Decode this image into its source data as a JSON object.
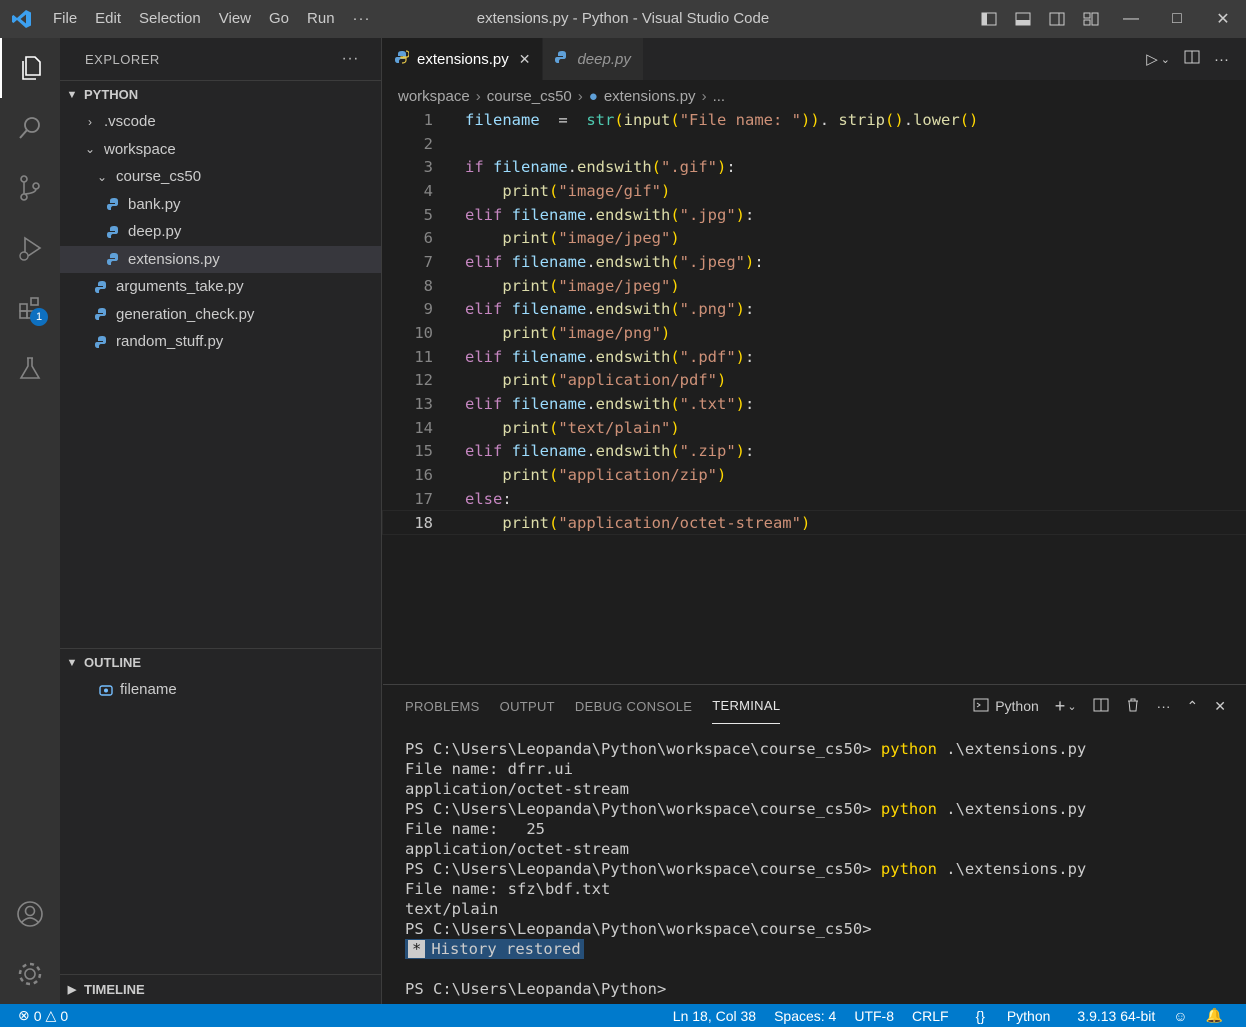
{
  "titlebar": {
    "menu": [
      "File",
      "Edit",
      "Selection",
      "View",
      "Go",
      "Run"
    ],
    "more": "···",
    "title": "extensions.py - Python - Visual Studio Code"
  },
  "activity": {
    "extensions_badge": "1"
  },
  "explorer": {
    "header": "EXPLORER",
    "section": "PYTHON",
    "tree": [
      {
        "label": ".vscode",
        "type": "folder",
        "expanded": false,
        "depth": 1
      },
      {
        "label": "workspace",
        "type": "folder",
        "expanded": true,
        "depth": 1
      },
      {
        "label": "course_cs50",
        "type": "folder",
        "expanded": true,
        "depth": 2
      },
      {
        "label": "bank.py",
        "type": "file",
        "depth": 3
      },
      {
        "label": "deep.py",
        "type": "file",
        "depth": 3
      },
      {
        "label": "extensions.py",
        "type": "file",
        "depth": 3,
        "selected": true
      },
      {
        "label": "arguments_take.py",
        "type": "file",
        "depth": 2
      },
      {
        "label": "generation_check.py",
        "type": "file",
        "depth": 2
      },
      {
        "label": "random_stuff.py",
        "type": "file",
        "depth": 2
      }
    ],
    "outline_title": "OUTLINE",
    "outline_item": "filename",
    "timeline_title": "TIMELINE"
  },
  "tabs": [
    {
      "label": "extensions.py",
      "active": true
    },
    {
      "label": "deep.py",
      "active": false
    }
  ],
  "breadcrumb": [
    "workspace",
    "course_cs50",
    "extensions.py",
    "..."
  ],
  "code_lines": [
    [
      [
        "var",
        "filename"
      ],
      [
        "",
        "  =  "
      ],
      [
        "bi",
        "str"
      ],
      [
        "pn",
        "("
      ],
      [
        "fn",
        "input"
      ],
      [
        "pn",
        "("
      ],
      [
        "str",
        "\"File name: \""
      ],
      [
        "pn",
        "))"
      ],
      [
        "",
        ". "
      ],
      [
        "fn",
        "strip"
      ],
      [
        "pn",
        "()"
      ],
      [
        "",
        "."
      ],
      [
        "fn",
        "lower"
      ],
      [
        "pn",
        "()"
      ]
    ],
    [],
    [
      [
        "kw",
        "if"
      ],
      [
        "",
        " "
      ],
      [
        "var",
        "filename"
      ],
      [
        "",
        "."
      ],
      [
        "fn",
        "endswith"
      ],
      [
        "pn",
        "("
      ],
      [
        "str",
        "\".gif\""
      ],
      [
        "pn",
        ")"
      ],
      [
        "",
        ":"
      ]
    ],
    [
      [
        "",
        "    "
      ],
      [
        "fn",
        "print"
      ],
      [
        "pn",
        "("
      ],
      [
        "str",
        "\"image/gif\""
      ],
      [
        "pn",
        ")"
      ]
    ],
    [
      [
        "kw",
        "elif"
      ],
      [
        "",
        " "
      ],
      [
        "var",
        "filename"
      ],
      [
        "",
        "."
      ],
      [
        "fn",
        "endswith"
      ],
      [
        "pn",
        "("
      ],
      [
        "str",
        "\".jpg\""
      ],
      [
        "pn",
        ")"
      ],
      [
        "",
        ":"
      ]
    ],
    [
      [
        "",
        "    "
      ],
      [
        "fn",
        "print"
      ],
      [
        "pn",
        "("
      ],
      [
        "str",
        "\"image/jpeg\""
      ],
      [
        "pn",
        ")"
      ]
    ],
    [
      [
        "kw",
        "elif"
      ],
      [
        "",
        " "
      ],
      [
        "var",
        "filename"
      ],
      [
        "",
        "."
      ],
      [
        "fn",
        "endswith"
      ],
      [
        "pn",
        "("
      ],
      [
        "str",
        "\".jpeg\""
      ],
      [
        "pn",
        ")"
      ],
      [
        "",
        ":"
      ]
    ],
    [
      [
        "",
        "    "
      ],
      [
        "fn",
        "print"
      ],
      [
        "pn",
        "("
      ],
      [
        "str",
        "\"image/jpeg\""
      ],
      [
        "pn",
        ")"
      ]
    ],
    [
      [
        "kw",
        "elif"
      ],
      [
        "",
        " "
      ],
      [
        "var",
        "filename"
      ],
      [
        "",
        "."
      ],
      [
        "fn",
        "endswith"
      ],
      [
        "pn",
        "("
      ],
      [
        "str",
        "\".png\""
      ],
      [
        "pn",
        ")"
      ],
      [
        "",
        ":"
      ]
    ],
    [
      [
        "",
        "    "
      ],
      [
        "fn",
        "print"
      ],
      [
        "pn",
        "("
      ],
      [
        "str",
        "\"image/png\""
      ],
      [
        "pn",
        ")"
      ]
    ],
    [
      [
        "kw",
        "elif"
      ],
      [
        "",
        " "
      ],
      [
        "var",
        "filename"
      ],
      [
        "",
        "."
      ],
      [
        "fn",
        "endswith"
      ],
      [
        "pn",
        "("
      ],
      [
        "str",
        "\".pdf\""
      ],
      [
        "pn",
        ")"
      ],
      [
        "",
        ":"
      ]
    ],
    [
      [
        "",
        "    "
      ],
      [
        "fn",
        "print"
      ],
      [
        "pn",
        "("
      ],
      [
        "str",
        "\"application/pdf\""
      ],
      [
        "pn",
        ")"
      ]
    ],
    [
      [
        "kw",
        "elif"
      ],
      [
        "",
        " "
      ],
      [
        "var",
        "filename"
      ],
      [
        "",
        "."
      ],
      [
        "fn",
        "endswith"
      ],
      [
        "pn",
        "("
      ],
      [
        "str",
        "\".txt\""
      ],
      [
        "pn",
        ")"
      ],
      [
        "",
        ":"
      ]
    ],
    [
      [
        "",
        "    "
      ],
      [
        "fn",
        "print"
      ],
      [
        "pn",
        "("
      ],
      [
        "str",
        "\"text/plain\""
      ],
      [
        "pn",
        ")"
      ]
    ],
    [
      [
        "kw",
        "elif"
      ],
      [
        "",
        " "
      ],
      [
        "var",
        "filename"
      ],
      [
        "",
        "."
      ],
      [
        "fn",
        "endswith"
      ],
      [
        "pn",
        "("
      ],
      [
        "str",
        "\".zip\""
      ],
      [
        "pn",
        ")"
      ],
      [
        "",
        ":"
      ]
    ],
    [
      [
        "",
        "    "
      ],
      [
        "fn",
        "print"
      ],
      [
        "pn",
        "("
      ],
      [
        "str",
        "\"application/zip\""
      ],
      [
        "pn",
        ")"
      ]
    ],
    [
      [
        "kw",
        "else"
      ],
      [
        "",
        ":"
      ]
    ],
    [
      [
        "",
        "    "
      ],
      [
        "fn",
        "print"
      ],
      [
        "pn",
        "("
      ],
      [
        "str",
        "\"application/octet-stream\""
      ],
      [
        "pn",
        ")"
      ]
    ]
  ],
  "current_line": 18,
  "panel": {
    "tabs": [
      "PROBLEMS",
      "OUTPUT",
      "DEBUG CONSOLE",
      "TERMINAL"
    ],
    "active_tab": "TERMINAL",
    "shell_label": "Python"
  },
  "terminal_lines": [
    [
      [
        "",
        "PS C:\\Users\\Leopanda\\Python\\workspace\\course_cs50> "
      ],
      [
        "cmd",
        "python"
      ],
      [
        "",
        " .\\extensions.py"
      ]
    ],
    [
      [
        "",
        "File name: dfrr.ui"
      ]
    ],
    [
      [
        "",
        "application/octet-stream"
      ]
    ],
    [
      [
        "",
        "PS C:\\Users\\Leopanda\\Python\\workspace\\course_cs50> "
      ],
      [
        "cmd",
        "python"
      ],
      [
        "",
        " .\\extensions.py"
      ]
    ],
    [
      [
        "",
        "File name:   25"
      ]
    ],
    [
      [
        "",
        "application/octet-stream"
      ]
    ],
    [
      [
        "",
        "PS C:\\Users\\Leopanda\\Python\\workspace\\course_cs50> "
      ],
      [
        "cmd",
        "python"
      ],
      [
        "",
        " .\\extensions.py"
      ]
    ],
    [
      [
        "",
        "File name: sfz\\bdf.txt"
      ]
    ],
    [
      [
        "",
        "text/plain"
      ]
    ],
    [
      [
        "",
        "PS C:\\Users\\Leopanda\\Python\\workspace\\course_cs50>"
      ]
    ]
  ],
  "history_mark": "*",
  "history_text": "History restored",
  "terminal_prompt": "PS C:\\Users\\Leopanda\\Python>",
  "status": {
    "errors": "0",
    "warnings": "0",
    "position": "Ln 18, Col 38",
    "spaces": "Spaces: 4",
    "encoding": "UTF-8",
    "eol": "CRLF",
    "language": "Python",
    "interpreter": "3.9.13 64-bit"
  }
}
